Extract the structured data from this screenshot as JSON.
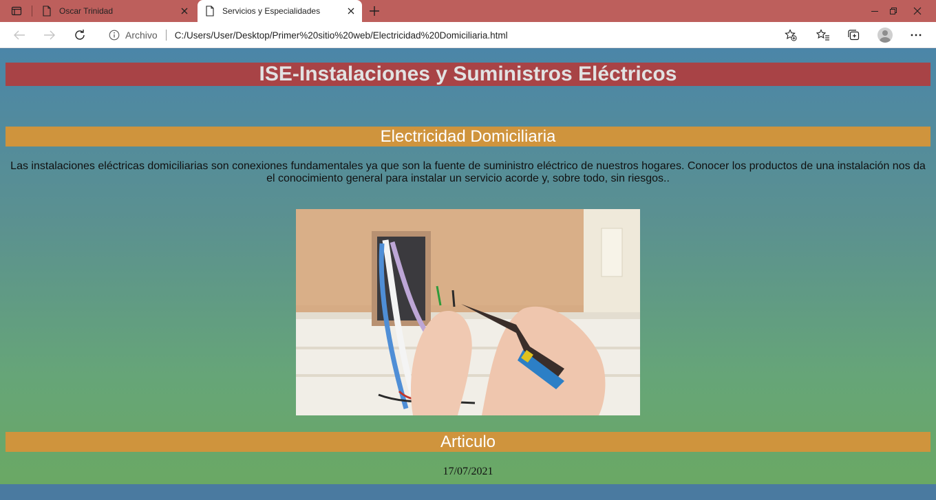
{
  "browser": {
    "tabs": [
      {
        "title": "Oscar Trinidad",
        "active": false
      },
      {
        "title": "Servicios y Especialidades",
        "active": true
      }
    ],
    "address": {
      "security_label": "Archivo",
      "url": "C:/Users/User/Desktop/Primer%20sitio%20web/Electricidad%20Domiciliaria.html"
    },
    "icons": {
      "tab_actions": "tab-actions-icon",
      "page": "page-icon",
      "close": "close-icon",
      "new_tab": "plus-icon",
      "back": "back-arrow-icon",
      "forward": "forward-arrow-icon",
      "refresh": "refresh-icon",
      "info": "info-icon",
      "add_favorite": "star-plus-icon",
      "favorites": "favorites-icon",
      "collections": "collections-icon",
      "profile": "avatar",
      "more": "more-icon"
    }
  },
  "page": {
    "banner_title": "ISE-Instalaciones y Suministros Eléctricos",
    "section_title": "Electricidad Domiciliaria",
    "intro": "Las instalaciones eléctricas domiciliarias son conexiones fundamentales ya que son la fuente de suministro eléctrico de nuestros hogares. Conocer los productos de una instalación nos da el conocimiento general para instalar un servicio acorde y, sobre todo, sin riesgos..",
    "article_title": "Articulo",
    "date": "17/07/2021"
  },
  "colors": {
    "tabstrip": "#bd5f5c",
    "banner": "#a84346",
    "section": "#cf943d",
    "page_top": "#4b86a8",
    "page_bottom": "#6aa864"
  }
}
